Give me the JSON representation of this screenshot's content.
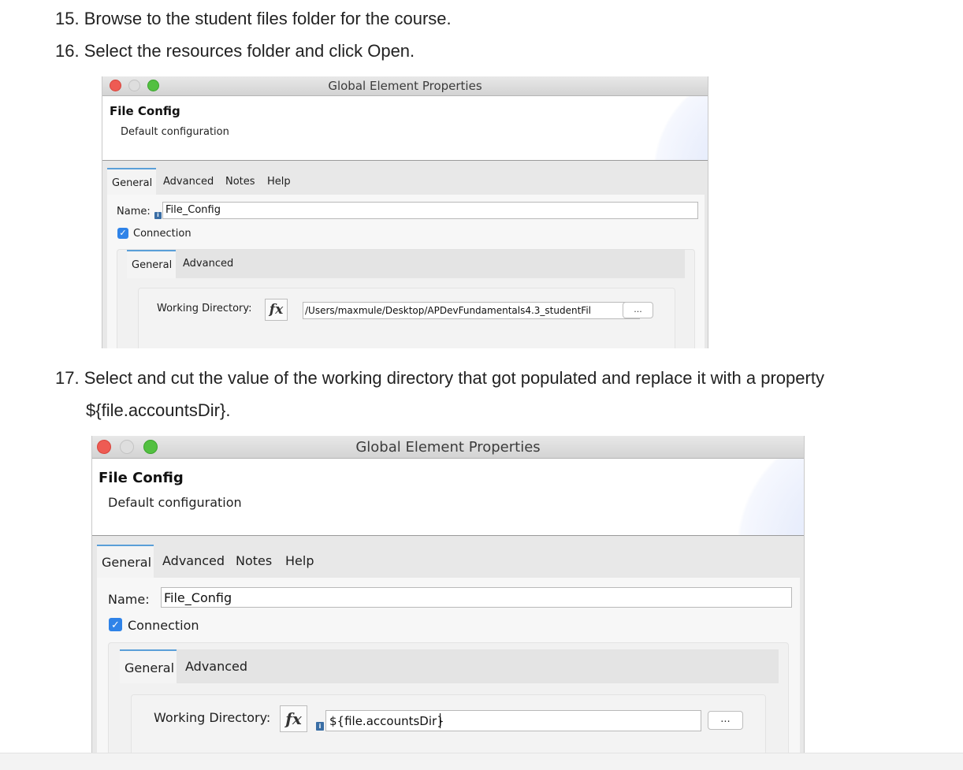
{
  "steps": {
    "s15": {
      "num": "15.",
      "text": "Browse to the student files folder for the course."
    },
    "s16": {
      "num": "16.",
      "text": "Select the resources folder and click Open."
    },
    "s17": {
      "num": "17.",
      "text": "Select and cut the value of the working directory that got populated and replace it with a property",
      "cont": "${file.accountsDir}."
    }
  },
  "window1": {
    "title": "Global Element Properties",
    "heading": "File Config",
    "subheading": "Default configuration",
    "tabs": [
      "General",
      "Advanced",
      "Notes",
      "Help"
    ],
    "name_label": "Name:",
    "name_value": "File_Config",
    "connection_label": "Connection",
    "connection_checked": true,
    "inner_tabs": [
      "General",
      "Advanced"
    ],
    "working_dir_label": "Working Directory:",
    "fx_label": "fx",
    "working_dir_value": "/Users/maxmule/Desktop/APDevFundamentals4.3_studentFil",
    "browse_label": "..."
  },
  "window2": {
    "title": "Global Element Properties",
    "heading": "File Config",
    "subheading": "Default configuration",
    "tabs": [
      "General",
      "Advanced",
      "Notes",
      "Help"
    ],
    "name_label": "Name:",
    "name_value": "File_Config",
    "connection_label": "Connection",
    "connection_checked": true,
    "inner_tabs": [
      "General",
      "Advanced"
    ],
    "working_dir_label": "Working Directory:",
    "fx_label": "fx",
    "working_dir_value": "${file.accountsDir}",
    "browse_label": "..."
  },
  "icons": {
    "info": "i",
    "check": "✓"
  },
  "colors": {
    "close": "#ee5b53",
    "minimize": "#dedede",
    "zoom": "#53c041",
    "checkbox": "#2f83e8",
    "active_tab_accent": "#5a9fd8"
  }
}
